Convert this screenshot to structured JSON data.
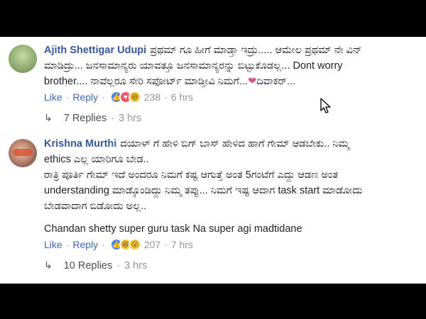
{
  "comments": [
    {
      "author": "Ajith Shettigar Udupi",
      "lines": [
        "ಪ್ರಥಮ್ ಗೂ ಹೀಗೆ ಮಾಡ್ತಾ ಇದ್ರು..... ಆಮೇಲ ಪ್ರಥಮ್ ನೇ ವಿನ್",
        "ಮಾಡಿದ್ರು... ಜನಸಾಮಾನ್ಯರು ಯಾವತ್ತೂ ಜನಸಾಮಾನ್ಯರನ್ನು ಬಿಟ್ಟುಕೊಡಲ್ಲ... Dont worry",
        "brother.... ನಾವೆಲ್ಲರೂ ಸೇರಿ ಸಪೋರ್ಟ್ ಮಾಡ್ತೀವಿ ನಿಮಗೆ...",
        "ದಿವಾಕರ್..."
      ],
      "heart": "❤",
      "like_label": "Like",
      "reply_label": "Reply",
      "reactions_count": "238",
      "time": "6 hrs",
      "replies_label": "7 Replies",
      "replies_time": "3 hrs"
    },
    {
      "author": "Krishna Murthi",
      "lines": [
        "ದಯಾಳ್ ಗೆ ಹೇಳಿ ಬಿಗ್ ಬಾಸ್ ಹೇಳಿದ ಹಾಗೆ ಗೇಮ್ ಆಡಬೇಕು.. ನಿಮ್ಮ",
        "ethics ಎಲ್ಲ ಯಾರಿಗೂ ಬೇಡ..",
        "ರಾತ್ರಿ ಪೂರ್ತಿ ಗೇಮ್ ಇದೆ ಅಂದರೂ ನಿಮಗೆ ಕಷ್ಟ ಆಗುತ್ತೆ ಅಂತ 5ಗಂಟೆಗೆ ಎದ್ದು ಆಡಣ ಅಂತ",
        "understanding ಮಾಡ್ಕೊಂಡಿದ್ದು ನಿಮ್ಮ ತಪ್ಪು... ನಿಮಗೆ ಇಷ್ಟ ಆದಾಗ task start ಮಾಡೋದು",
        "ಬೇಡವಾದಾಗ ಬಿಡೋದು ಅಲ್ಲ..",
        "Chandan shetty super guru task Na super agi madtidane"
      ],
      "like_label": "Like",
      "reply_label": "Reply",
      "reactions_count": "207",
      "time": "7 hrs",
      "replies_label": "10 Replies",
      "replies_time": "3 hrs"
    }
  ],
  "separator": "·",
  "colors": {
    "author": "#365899",
    "link": "#4267b2",
    "meta": "#90949c",
    "text": "#1d2129"
  },
  "icons": {
    "reply_arrow": "reply-arrow-icon",
    "cursor": "mouse-pointer-icon"
  }
}
